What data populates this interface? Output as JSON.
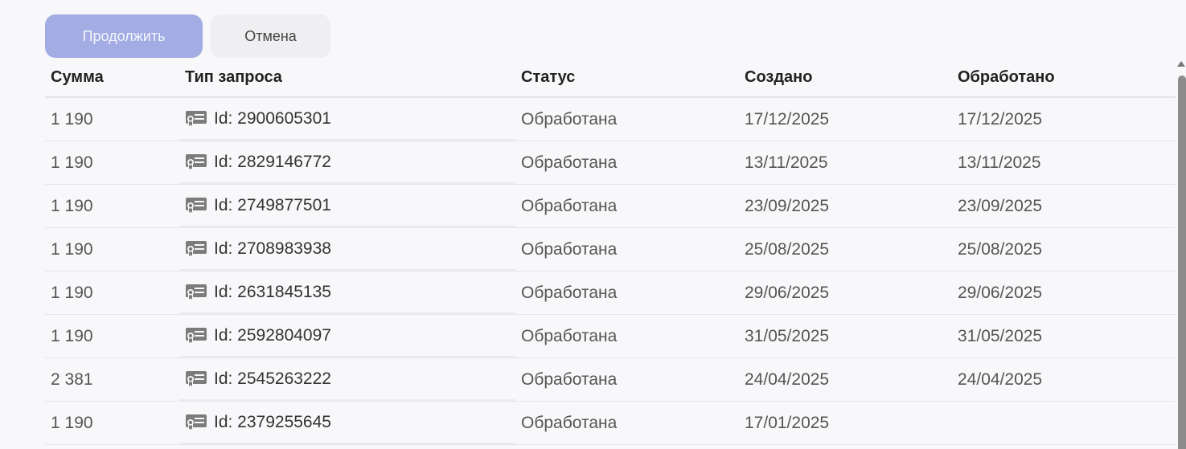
{
  "actions": {
    "continue_label": "Продолжить",
    "cancel_label": "Отмена"
  },
  "colors": {
    "primary_button": "#a4ade3",
    "secondary_button": "#efeff1"
  },
  "table": {
    "headers": {
      "sum": "Сумма",
      "type": "Тип запроса",
      "status": "Статус",
      "created": "Создано",
      "processed": "Обработано"
    },
    "rows": [
      {
        "sum": "1 190",
        "type": "Id: 2900605301",
        "status": "Обработана",
        "created": "17/12/2025",
        "processed": "17/12/2025"
      },
      {
        "sum": "1 190",
        "type": "Id: 2829146772",
        "status": "Обработана",
        "created": "13/11/2025",
        "processed": "13/11/2025"
      },
      {
        "sum": "1 190",
        "type": "Id: 2749877501",
        "status": "Обработана",
        "created": "23/09/2025",
        "processed": "23/09/2025"
      },
      {
        "sum": "1 190",
        "type": "Id: 2708983938",
        "status": "Обработана",
        "created": "25/08/2025",
        "processed": "25/08/2025"
      },
      {
        "sum": "1 190",
        "type": "Id: 2631845135",
        "status": "Обработана",
        "created": "29/06/2025",
        "processed": "29/06/2025"
      },
      {
        "sum": "1 190",
        "type": "Id: 2592804097",
        "status": "Обработана",
        "created": "31/05/2025",
        "processed": "31/05/2025"
      },
      {
        "sum": "2 381",
        "type": "Id: 2545263222",
        "status": "Обработана",
        "created": "24/04/2025",
        "processed": "24/04/2025"
      },
      {
        "sum": "1 190",
        "type": "Id: 2379255645",
        "status": "Обработана",
        "created": "17/01/2025",
        "processed": ""
      }
    ],
    "type_icon": "certificate-icon"
  }
}
